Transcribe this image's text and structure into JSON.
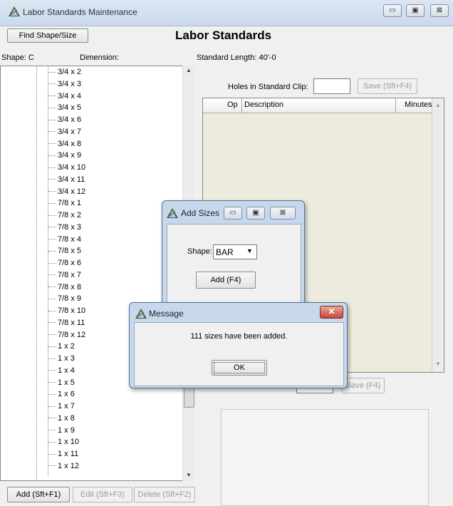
{
  "window": {
    "title": "Labor Standards Maintenance",
    "buttons": {
      "minimize": "▭",
      "maximize": "▣",
      "close": "⊠"
    }
  },
  "toolbar": {
    "find_shape_size": "Find Shape/Size"
  },
  "heading": "Labor Standards",
  "left_panel": {
    "shape_label": "Shape: C",
    "dimension_label": "Dimension:",
    "tree_items": [
      "3/4 x 2",
      "3/4 x 3",
      "3/4 x 4",
      "3/4 x 5",
      "3/4 x 6",
      "3/4 x 7",
      "3/4 x 8",
      "3/4 x 9",
      "3/4 x 10",
      "3/4 x 11",
      "3/4 x 12",
      "7/8 x 1",
      "7/8 x 2",
      "7/8 x 3",
      "7/8 x 4",
      "7/8 x 5",
      "7/8 x 6",
      "7/8 x 7",
      "7/8 x 8",
      "7/8 x 9",
      "7/8 x 10",
      "7/8 x 11",
      "7/8 x 12",
      "1 x 2",
      "1 x 3",
      "1 x 4",
      "1 x 5",
      "1 x 6",
      "1 x 7",
      "1 x 8",
      "1 x 9",
      "1 x 10",
      "1 x 11",
      "1 x 12"
    ],
    "add_button": "Add (Sft+F1)",
    "edit_button": "Edit (Sft+F3)",
    "delete_button": "Delete (Sft+F2)"
  },
  "right_panel": {
    "standard_length": "Standard Length: 40'-0",
    "holes_label": "Holes in Standard Clip:",
    "holes_value": "",
    "save_top": "Save (Sft+F4)",
    "grid_columns": [
      "Op",
      "Description",
      "Minutes"
    ],
    "save_bottom": "Save (F4)"
  },
  "add_sizes_dialog": {
    "title": "Add Sizes",
    "shape_label": "Shape:",
    "shape_value": "BAR",
    "add_button": "Add (F4)"
  },
  "message_dialog": {
    "title": "Message",
    "text": "111 sizes have been added.",
    "ok_button": "OK"
  },
  "icons": {
    "app": "app-pyramid-icon",
    "dropdown": "chevron-down-icon",
    "scroll_up": "up-arrow-icon",
    "scroll_down": "down-arrow-icon"
  },
  "colors": {
    "grid_background": "#ecebdd",
    "close_button": "#c7453a"
  }
}
